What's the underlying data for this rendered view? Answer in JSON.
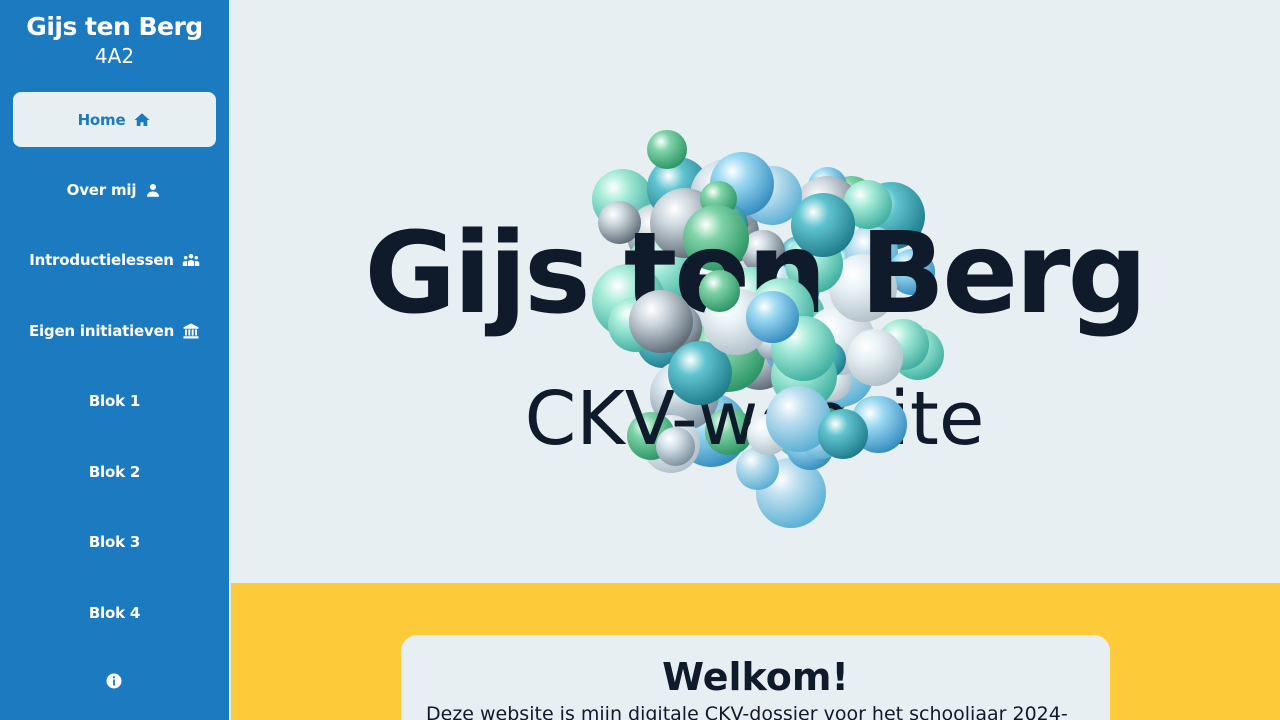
{
  "sidebar": {
    "name": "Gijs ten Berg",
    "class": "4A2",
    "items": [
      {
        "label": "Home",
        "icon": "home-icon"
      },
      {
        "label": "Over mij",
        "icon": "user-icon"
      },
      {
        "label": "Introductielessen",
        "icon": "group-icon"
      },
      {
        "label": "Eigen initiatieven",
        "icon": "museum-icon"
      },
      {
        "label": "Blok 1"
      },
      {
        "label": "Blok 2"
      },
      {
        "label": "Blok 3"
      },
      {
        "label": "Blok 4"
      }
    ],
    "info_icon": "info-icon"
  },
  "hero": {
    "title": "Gijs ten Berg",
    "subtitle": "CKV-website"
  },
  "welcome": {
    "title": "Welkom!",
    "text": "Deze website is mijn digitale CKV-dossier voor het schooljaar 2024-"
  },
  "colors": {
    "sidebar": "#1b7ac0",
    "background": "#e8eff3",
    "accent_yellow": "#fdca3a",
    "text_dark": "#0f1a2b"
  }
}
